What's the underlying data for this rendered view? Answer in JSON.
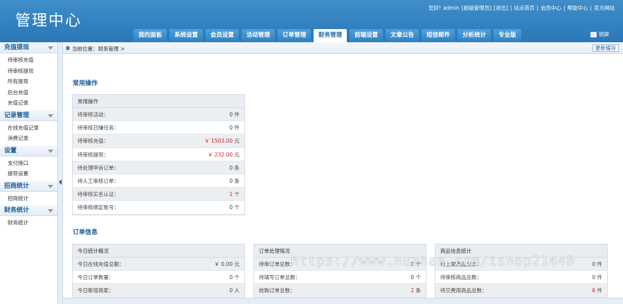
{
  "header": {
    "logo": "管理中心",
    "toplinks": [
      "您好!",
      "admin",
      "[超级管理员]",
      "[退出]",
      "|",
      "站点首页",
      "|",
      "会员中心",
      "|",
      "帮助中心",
      "|",
      "官方网站"
    ],
    "lock_label": "锁屏",
    "tabs": [
      "我的面板",
      "系统设置",
      "会员设置",
      "活动管理",
      "订单管理",
      "财务管理",
      "前端设置",
      "文章公告",
      "短信邮件",
      "分析统计",
      "专业版"
    ],
    "active_tab": "财务管理"
  },
  "sidebar": {
    "groups": [
      {
        "title": "充值提现",
        "items": [
          "待审核充值",
          "待审核提现",
          "所有提现",
          "后台充值",
          "充值记录"
        ]
      },
      {
        "title": "记录管理",
        "items": [
          "在线充值记录",
          "消费记录"
        ]
      },
      {
        "title": "设置",
        "items": [
          "支付接口",
          "提现设置"
        ]
      },
      {
        "title": "招商统计",
        "items": [
          "招商统计"
        ]
      },
      {
        "title": "财务统计",
        "items": [
          "财务统计"
        ]
      }
    ]
  },
  "breadcrumb": {
    "label": "当前位置：",
    "path": "财务管理 >"
  },
  "refresh_label": "更新缓存",
  "section1": {
    "title": "常用操作",
    "panel_title": "常用操作",
    "rows": [
      {
        "label": "待审核活动：",
        "value": "0 件",
        "red": false
      },
      {
        "label": "待审核日赚任务：",
        "value": "0 件",
        "red": false
      },
      {
        "label": "待审核充值：",
        "value": "￥ 1503.00",
        "unit": " 元",
        "red": true
      },
      {
        "label": "待审核提现：",
        "value": "￥ 232.00",
        "unit": " 元",
        "red": true
      },
      {
        "label": "待处理申诉订单：",
        "value": "0 条",
        "red": false
      },
      {
        "label": "待人工审核订单：",
        "value": "0 条",
        "red": false
      },
      {
        "label": "待审核实名认证：",
        "value": "1",
        "unit": " 个",
        "red": true
      },
      {
        "label": "待审核绑定账号：",
        "value": "0 个",
        "red": false
      }
    ]
  },
  "section2": {
    "title": "订单信息",
    "panels": [
      {
        "title": "今日统计概况",
        "rows": [
          {
            "label": "今日在线充值总额：",
            "value": "￥ 0.00 元",
            "red": false
          },
          {
            "label": "今日订单数量：",
            "value": "0 个",
            "red": false
          },
          {
            "label": "今日新增商家：",
            "value": "0 人",
            "red": false
          }
        ]
      },
      {
        "title": "订单处理情况",
        "rows": [
          {
            "label": "待审订单总数：",
            "value": "0 个",
            "red": false
          },
          {
            "label": "待填写订单总数：",
            "value": "0 个",
            "red": false
          },
          {
            "label": "抢购订单总数：",
            "value": "2",
            "unit": " 条",
            "red": true
          }
        ]
      },
      {
        "title": "商品信息统计",
        "rows": [
          {
            "label": "待上架商品总数：",
            "value": "0 件",
            "red": false
          },
          {
            "label": "待审核商品总数：",
            "value": "0 件",
            "red": false
          },
          {
            "label": "待交费用商品总数：",
            "value": "6",
            "unit": " 件",
            "red": true
          }
        ]
      }
    ]
  },
  "watermark": "https://www.huzhan.com/ishop21448",
  "colors": {
    "header": "#2f80c0",
    "accent": "#1f5d9a",
    "alert": "#d02020"
  }
}
